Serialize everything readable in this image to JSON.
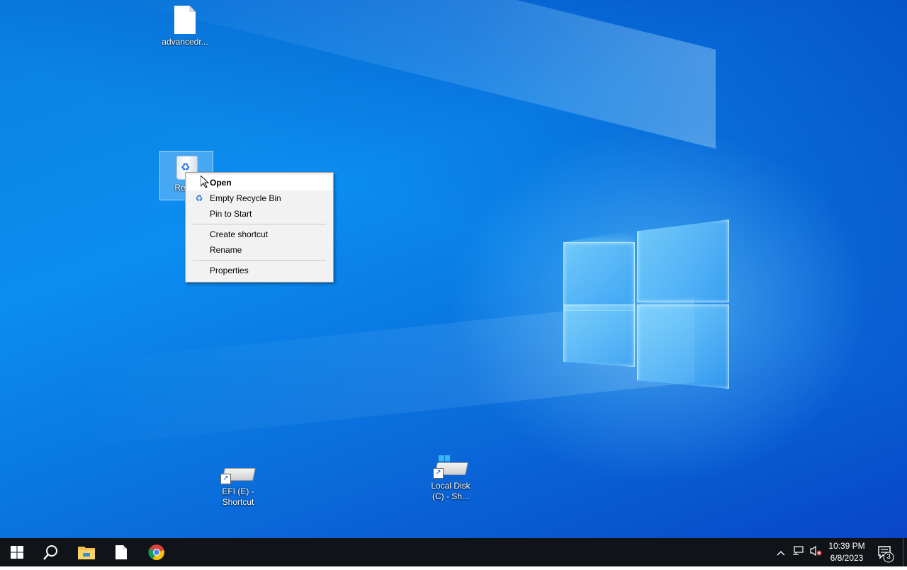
{
  "desktop": {
    "icons": [
      {
        "label": "advancedr...",
        "icon": "file-icon"
      },
      {
        "label": "Recyc",
        "icon": "recycle-bin-icon"
      },
      {
        "label": "EFI (E) - Shortcut",
        "icon": "drive-shortcut-icon"
      },
      {
        "label": "Local Disk (C) - Sh...",
        "icon": "drive-shortcut-icon"
      }
    ]
  },
  "context_menu": {
    "items": [
      {
        "label": "Open",
        "default": true
      },
      {
        "label": "Empty Recycle Bin",
        "icon": "recycle-bin-icon"
      },
      {
        "label": "Pin to Start"
      },
      {
        "label": "Create shortcut"
      },
      {
        "label": "Rename"
      },
      {
        "label": "Properties"
      }
    ]
  },
  "taskbar": {
    "apps": [
      {
        "name": "Start",
        "icon": "windows-start-icon"
      },
      {
        "name": "Search",
        "icon": "search-icon"
      },
      {
        "name": "File Explorer",
        "icon": "folder-icon"
      },
      {
        "name": "File",
        "icon": "file-icon"
      },
      {
        "name": "Chrome",
        "icon": "chrome-icon"
      }
    ],
    "tray": {
      "time": "10:39 PM",
      "date": "6/8/2023",
      "notification_count": "3"
    }
  },
  "colors": {
    "desktop_blue": "#0a7fe0",
    "taskbar": "#101318",
    "menu_bg": "#f2f2f2",
    "accent": "#1f74d6"
  }
}
